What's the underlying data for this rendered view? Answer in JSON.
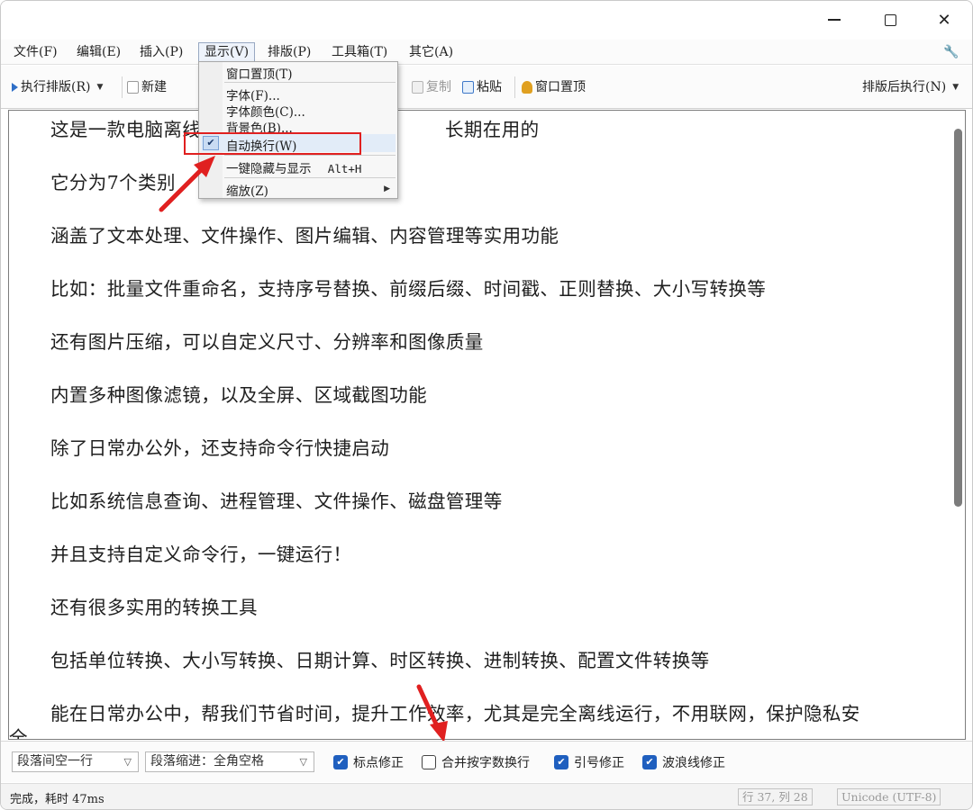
{
  "window": {
    "controls": {
      "minimize_icon": "minimize-icon",
      "maximize_icon": "maximize-icon",
      "close_icon": "close-icon"
    }
  },
  "menubar": {
    "items": [
      {
        "label": "文件(F)"
      },
      {
        "label": "编辑(E)"
      },
      {
        "label": "插入(P)"
      },
      {
        "label": "显示(V)"
      },
      {
        "label": "排版(P)"
      },
      {
        "label": "工具箱(T)"
      },
      {
        "label": "其它(A)"
      }
    ],
    "settings_icon": "wrench-icon"
  },
  "toolbar": {
    "run_format": "执行排版(R)",
    "new": "新建",
    "copy": "复制",
    "paste": "粘贴",
    "pin_window": "窗口置顶",
    "after_format_run": "排版后执行(N)"
  },
  "display_menu": {
    "items": [
      {
        "label": "窗口置顶(T)"
      },
      {
        "label": "字体(F)..."
      },
      {
        "label": "字体颜色(C)..."
      },
      {
        "label": "背景色(B)..."
      },
      {
        "label": "自动换行(W)",
        "checked": true
      },
      {
        "label": "一键隐藏与显示",
        "shortcut": "Alt+H"
      },
      {
        "label": "缩放(Z)"
      }
    ]
  },
  "editor": {
    "paragraphs": [
      "这是一款电脑离线",
      "它分为7个类别",
      "涵盖了文本处理、文件操作、图片编辑、内容管理等实用功能",
      "比如：批量文件重命名，支持序号替换、前缀后缀、时间戳、正则替换、大小写转换等",
      "还有图片压缩，可以自定义尺寸、分辨率和图像质量",
      "内置多种图像滤镜，以及全屏、区域截图功能",
      "除了日常办公外，还支持命令行快捷启动",
      "比如系统信息查询、进程管理、文件操作、磁盘管理等",
      "并且支持自定义命令行，一键运行！",
      "还有很多实用的转换工具",
      "包括单位转换、大小写转换、日期计算、时区转换、进制转换、配置文件转换等",
      "能在日常办公中，帮我们节省时间，提升工作效率，尤其是完全离线运行，不用联网，保护隐私安"
    ],
    "fragment_right": "长期在用的",
    "wrap_tail": "全。"
  },
  "options": {
    "para_spacing": "段落间空一行",
    "para_indent": "段落缩进：全角空格",
    "punct_fix": {
      "label": "标点修正",
      "checked": true
    },
    "merge_wrap": {
      "label": "合并按字数换行",
      "checked": false
    },
    "quote_fix": {
      "label": "引号修正",
      "checked": true
    },
    "tilde_fix": {
      "label": "波浪线修正",
      "checked": true
    }
  },
  "status": {
    "message": "完成，耗时 47ms",
    "position": "行 37, 列 28",
    "encoding": "Unicode (UTF-8)"
  },
  "colors": {
    "accent": "#1f5fbf",
    "annotation": "#e02020"
  }
}
